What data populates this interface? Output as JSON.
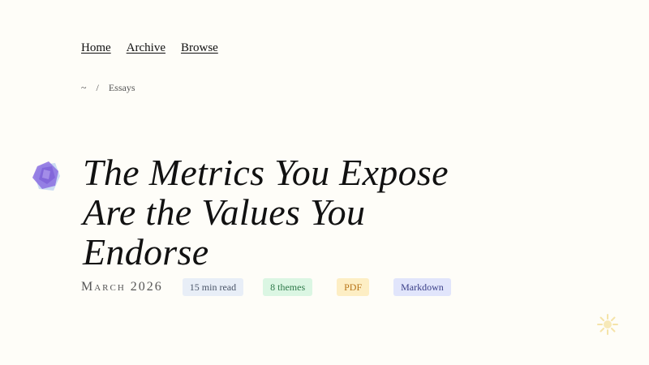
{
  "nav": {
    "items": [
      {
        "label": "Home"
      },
      {
        "label": "Archive"
      },
      {
        "label": "Browse"
      }
    ]
  },
  "breadcrumb": {
    "home": "~",
    "separator": "/",
    "current": "Essays"
  },
  "article": {
    "title": "The Metrics You Expose Are the Values You Endorse",
    "date": "March 2026",
    "tags": {
      "read_time": "15 min read",
      "themes": "8 themes",
      "pdf": "PDF",
      "markdown": "Markdown"
    }
  },
  "icons": {
    "logo": "purple-crystal-logo-icon",
    "corner": "sun-icon"
  },
  "colors": {
    "background": "#fefdf8",
    "logo_primary": "#8b6fe0",
    "logo_secondary": "#a9c4f0",
    "sun": "#f5e3a8"
  }
}
